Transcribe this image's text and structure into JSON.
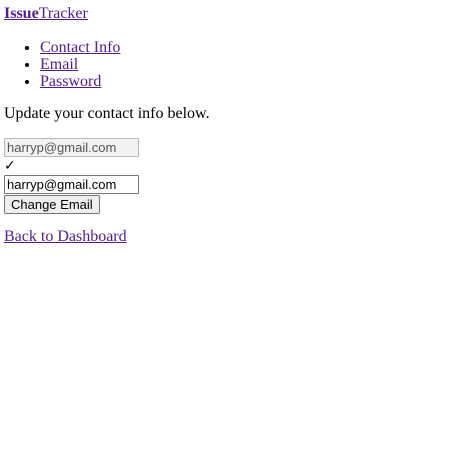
{
  "brand": {
    "bold": "Issue",
    "rest": "Tracker"
  },
  "nav": {
    "items": [
      {
        "label": "Contact Info"
      },
      {
        "label": "Email"
      },
      {
        "label": "Password"
      }
    ]
  },
  "intro": "Update your contact info below.",
  "form": {
    "current_email": "harryp@gmail.com",
    "check_glyph": "✓",
    "new_email": "harryp@gmail.com",
    "submit_label": "Change Email"
  },
  "back_link": "Back to Dashboard",
  "colors": {
    "link_visited": "#551a8b",
    "text": "#000000",
    "disabled_bg": "#f3f3f3"
  }
}
